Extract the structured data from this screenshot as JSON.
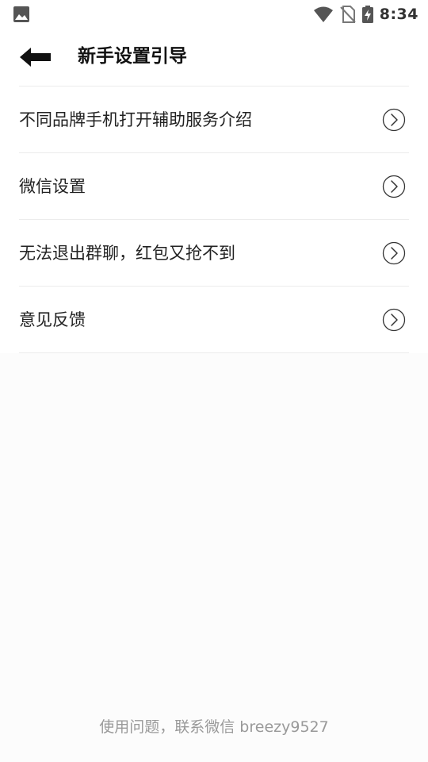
{
  "status_bar": {
    "time": "8:34",
    "left_icon": "image-icon",
    "right_icons": [
      "wifi-icon",
      "no-sim-icon",
      "battery-charging-icon"
    ]
  },
  "header": {
    "back_icon": "back-arrow-icon",
    "title": "新手设置引导"
  },
  "menu": {
    "items": [
      {
        "label": "不同品牌手机打开辅助服务介绍"
      },
      {
        "label": "微信设置"
      },
      {
        "label": "无法退出群聊，红包又抢不到"
      },
      {
        "label": "意见反馈"
      }
    ]
  },
  "footer": {
    "text": "使用问题，联系微信 breezy9527"
  },
  "colors": {
    "background": "#fcfcfc",
    "surface": "#ffffff",
    "divider": "#ececec",
    "footer_text": "#999999"
  }
}
